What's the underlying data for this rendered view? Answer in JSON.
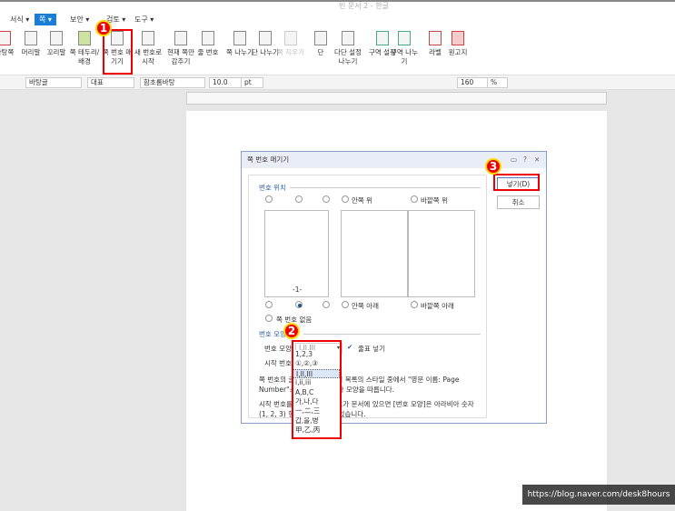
{
  "window": {
    "title": "빈 문서 2 - 한글"
  },
  "menu": {
    "tabs": [
      {
        "label": "서식 ▾"
      },
      {
        "label": "쪽 ▾"
      },
      {
        "label": "보안 ▾"
      },
      {
        "label": "검토 ▾"
      },
      {
        "label": "도구 ▾"
      }
    ]
  },
  "ribbon": {
    "items": [
      {
        "label": "바탕쪽"
      },
      {
        "label": "머리말"
      },
      {
        "label": "꼬리말"
      },
      {
        "label": "쪽 테두리/ 배경"
      },
      {
        "label": "쪽 번호 매기기"
      },
      {
        "label": "새 번호로 시작"
      },
      {
        "label": "현재 쪽만 감추기"
      },
      {
        "label": "줄 번호"
      },
      {
        "label": "쪽 나누기"
      },
      {
        "label": "단 나누기"
      },
      {
        "label": "쪽 지우기"
      },
      {
        "label": "단"
      },
      {
        "label": "다단 설정 나누기"
      },
      {
        "label": "구역 설정"
      },
      {
        "label": "구역 나누기"
      },
      {
        "label": "라벨"
      },
      {
        "label": "원고지"
      }
    ]
  },
  "format_bar": {
    "style": "바탕글",
    "lang": "대표",
    "font": "함초롬바탕",
    "size": "10.0",
    "size_unit": "pt",
    "zoom": "160",
    "zoom_unit": "%"
  },
  "dialog": {
    "title": "쪽 번호 매기기",
    "position_section": "번호 위치",
    "inner_top": "안쪽 위",
    "outer_top": "바깥쪽 위",
    "inner_bottom": "안쪽 아래",
    "outer_bottom": "바깥쪽 아래",
    "no_number": "쪽 번호 없음",
    "preview": "-1-",
    "shape_section": "번호 모양",
    "shape_label": "번호 모양",
    "shape_value": "I,II,III",
    "dash_label": "줄표 넣기",
    "start_label": "시작 번호",
    "note1": "쪽 번호의 글자 모양은 스타일 목록의 스타일 중에서 \"영문 이름: Page Number\"스타일의 영문 글자 모양을 따릅니다.",
    "note2": "시작 번호를 바꾸거나 새 번호가 문서에 있으면 [번호 모양]은 아라비아 숫자 (1, 2, 3) 형식으로 바뀔 수 있습니다.",
    "insert_button": "넣기(D)",
    "cancel_button": "취소",
    "options": [
      "1,2,3",
      "①,②,③",
      "I,II,III",
      "i,ii,iii",
      "A,B,C",
      "가,나,다",
      "一,二,三",
      "갑,을,병",
      "甲,乙,丙"
    ]
  },
  "badges": [
    "1",
    "2",
    "3"
  ],
  "watermark": "https://blog.naver.com/desk8hours"
}
